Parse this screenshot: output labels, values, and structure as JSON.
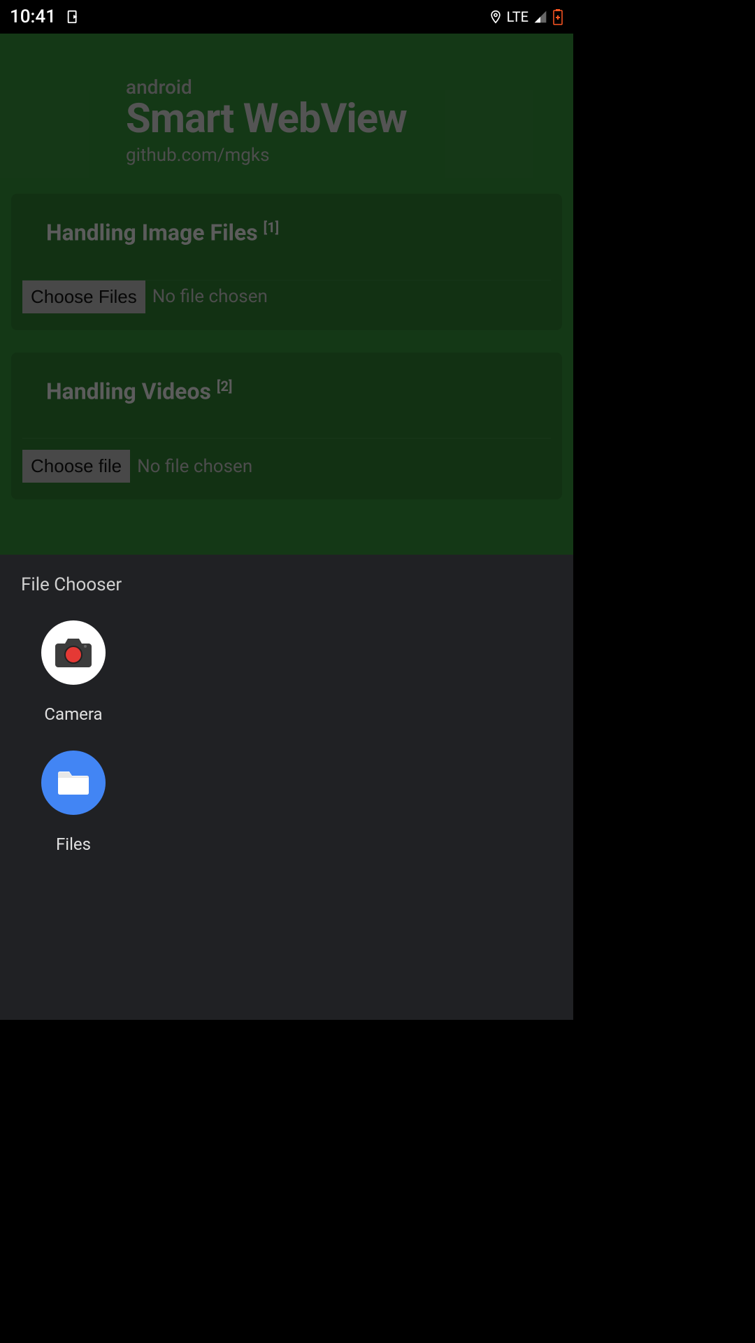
{
  "status_bar": {
    "time": "10:41",
    "network": "LTE"
  },
  "header": {
    "small": "android",
    "large": "Smart WebView",
    "link": "github.com/mgks"
  },
  "sections": [
    {
      "heading": "Handling Image Files ",
      "sup": "[1]",
      "button": "Choose Files",
      "status": "No file chosen"
    },
    {
      "heading": "Handling Videos ",
      "sup": "[2]",
      "button": "Choose file",
      "status": "No file chosen"
    }
  ],
  "chooser": {
    "title": "File Chooser",
    "items": [
      {
        "label": "Camera"
      },
      {
        "label": "Files"
      }
    ]
  }
}
